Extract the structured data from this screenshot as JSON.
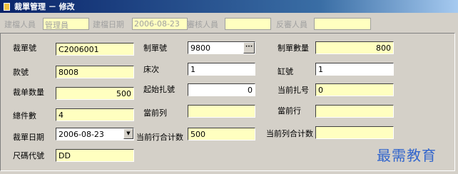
{
  "window": {
    "title": "裁單管理 － 修改"
  },
  "header": {
    "creator_label": "建檔人員",
    "creator_value": "管理員",
    "created_date_label": "建檔日期",
    "created_date_value": "2006-08-23",
    "reviewer_label": "審核人員",
    "reviewer_value": "",
    "unreviewer_label": "反審人員",
    "unreviewer_value": ""
  },
  "form": {
    "cut_no_label": "裁單號",
    "cut_no_value": "C2006001",
    "make_no_label": "制單號",
    "make_no_value": "9800",
    "make_no_button": "···",
    "make_qty_label": "制單數量",
    "make_qty_value": "800",
    "style_no_label": "款號",
    "style_no_value": "8008",
    "bed_no_label": "床次",
    "bed_no_value": "1",
    "cylinder_no_label": "缸號",
    "cylinder_no_value": "1",
    "cut_qty_label": "裁单数量",
    "cut_qty_value": "500",
    "start_bundle_label": "起始扎號",
    "start_bundle_value": "0",
    "cur_bundle_label": "当前扎号",
    "cur_bundle_value": "0",
    "total_pieces_label": "總件數",
    "total_pieces_value": "4",
    "cur_col_label": "當前列",
    "cur_col_value": "",
    "cur_row_label": "當前行",
    "cur_row_value": "",
    "cut_date_label": "裁單日期",
    "cut_date_value": "2006-08-23",
    "row_total_label": "当前行合计数",
    "row_total_value": "500",
    "col_total_label": "当前列合计数",
    "col_total_value": "",
    "size_code_label": "尺碼代號",
    "size_code_value": "DD"
  },
  "watermark": "最需教育"
}
